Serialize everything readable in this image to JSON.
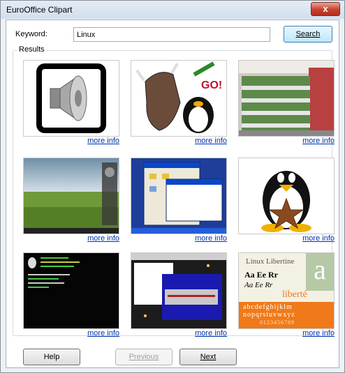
{
  "window": {
    "title": "EuroOffice Clipart",
    "close_label": "x"
  },
  "search": {
    "label": "Keyword:",
    "value": "Linux",
    "button_label": "Search"
  },
  "results": {
    "label": "Results",
    "more_info_label": "more info",
    "items": [
      {
        "name": "speaker-clipart"
      },
      {
        "name": "gnu-linux-go-clipart"
      },
      {
        "name": "store-display-photo"
      },
      {
        "name": "desktop-field-screenshot"
      },
      {
        "name": "windows-desktop-screenshot"
      },
      {
        "name": "tux-barnstar-clipart"
      },
      {
        "name": "terminal-screenshot"
      },
      {
        "name": "installer-screenshot"
      },
      {
        "name": "linux-libertine-sample",
        "sample": {
          "title": "Linux Libertine",
          "line1": "Aa Ee Rr",
          "line2": "Aa Ee Rr",
          "letter": "a",
          "word": "liberté",
          "lower1": "abcdefghijklm",
          "lower2": "nopqrstuvwxyz",
          "digits": "0123456789"
        }
      }
    ]
  },
  "buttons": {
    "help": "Help",
    "previous": "Previous",
    "next": "Next"
  },
  "colors": {
    "link": "#0033aa",
    "libertine_orange": "#f07a1a"
  }
}
